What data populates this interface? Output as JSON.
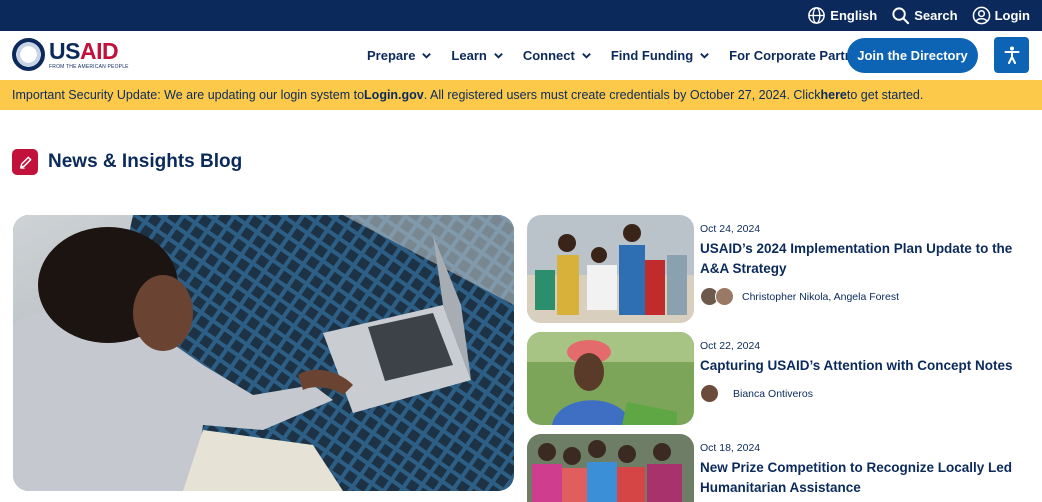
{
  "utility": {
    "language": "English",
    "search": "Search",
    "login": "Login"
  },
  "logo": {
    "word_us": "US",
    "word_aid": "AID",
    "tagline": "FROM THE AMERICAN PEOPLE"
  },
  "nav": {
    "items": [
      {
        "label": "Prepare",
        "has_dropdown": true
      },
      {
        "label": "Learn",
        "has_dropdown": true
      },
      {
        "label": "Connect",
        "has_dropdown": true
      },
      {
        "label": "Find Funding",
        "has_dropdown": true
      },
      {
        "label": "For Corporate Partners",
        "has_dropdown": false
      }
    ],
    "join_label": "Join the Directory",
    "accessibility_icon": "accessibility-icon"
  },
  "alert": {
    "prefix": "Important Security Update: We are updating our login system to ",
    "link_domain": "Login.gov",
    "middle": ". All registered users must create credentials by October 27, 2024. Click ",
    "link_here": "here",
    "suffix": " to get started."
  },
  "section": {
    "title": "News & Insights Blog",
    "icon": "pen-icon"
  },
  "featured": {
    "image": "woman-using-laptop-photo"
  },
  "posts": [
    {
      "date": "Oct 24, 2024",
      "title": "USAID’s 2024 Implementation Plan Update to the A&A Strategy",
      "authors": "Christopher Nikola, Angela Forest",
      "image": "people-carrying-sacks-photo"
    },
    {
      "date": "Oct 22, 2024",
      "title": "Capturing USAID’s Attention with Concept Notes",
      "authors": "Bianca Ontiveros",
      "image": "smiling-woman-field-photo"
    },
    {
      "date": "Oct 18, 2024",
      "title": "New Prize Competition to Recognize Locally Led Humanitarian Assistance",
      "authors": "",
      "image": "group-of-women-photo"
    }
  ],
  "colors": {
    "navy": "#0b2a5b",
    "brand_blue": "#0d64b5",
    "alert_yellow": "#fcc94a",
    "accent_red": "#c2113a"
  }
}
